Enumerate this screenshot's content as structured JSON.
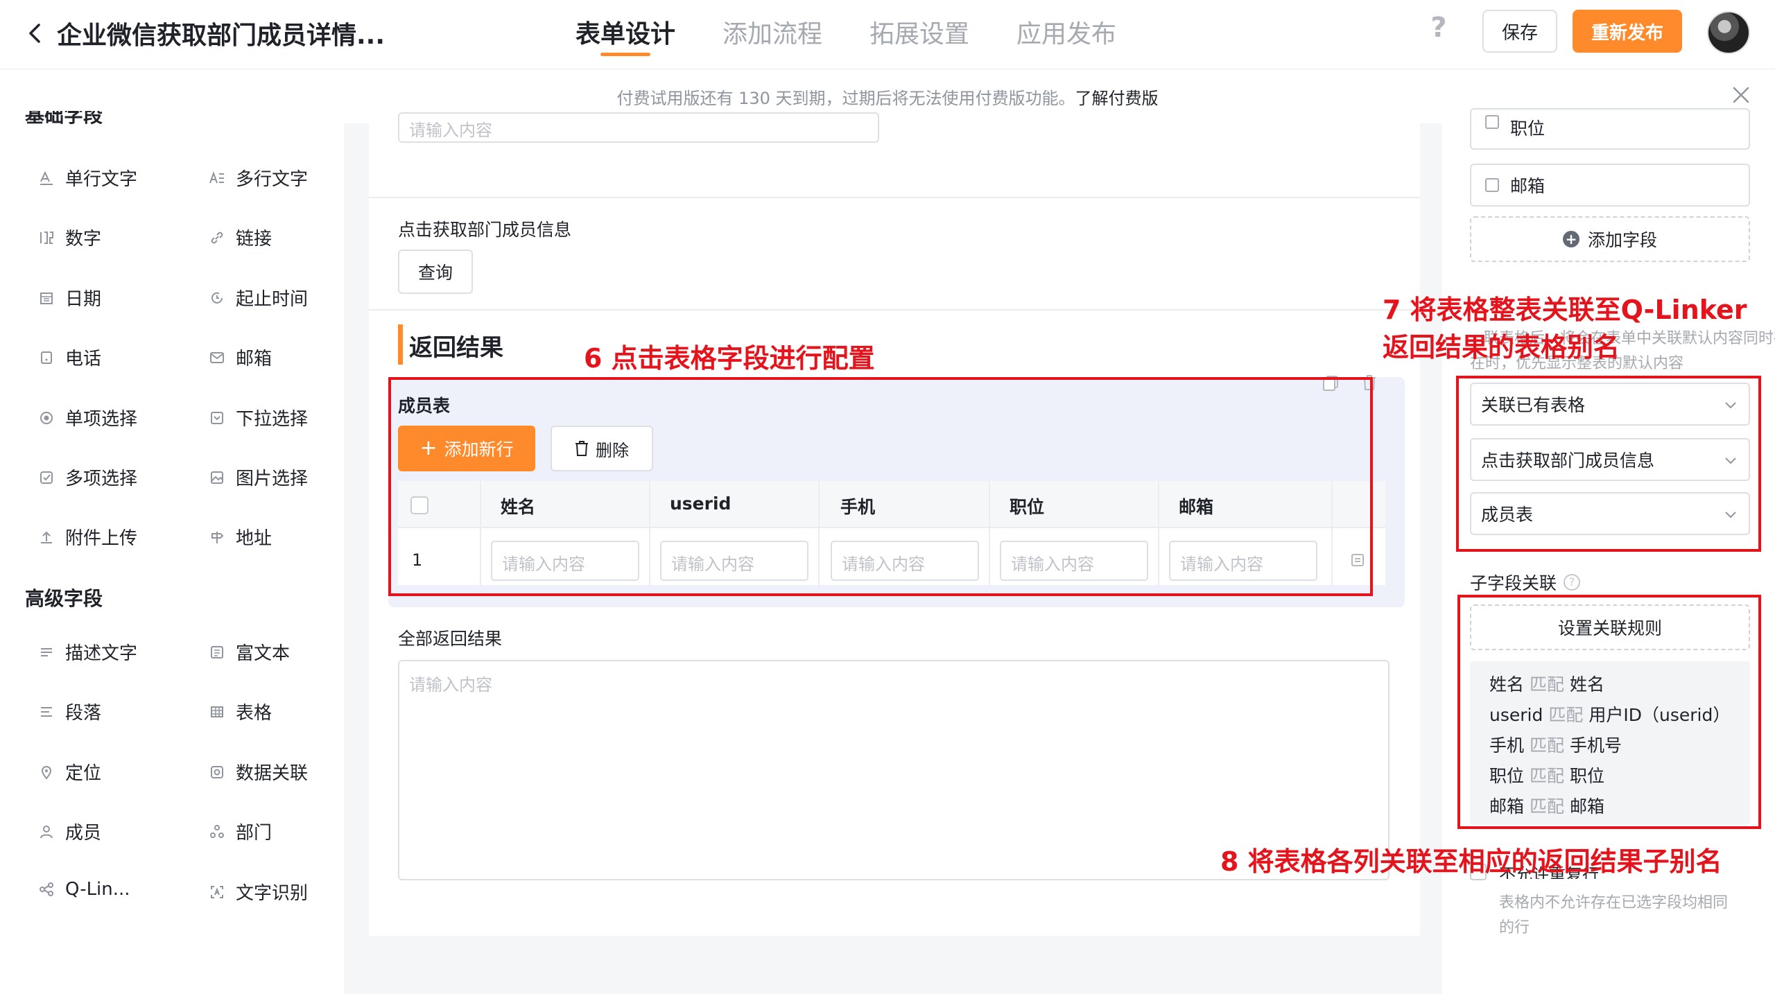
{
  "header": {
    "title": "企业微信获取部门成员详情...",
    "tabs": [
      {
        "label": "表单设计"
      },
      {
        "label": "添加流程"
      },
      {
        "label": "拓展设置"
      },
      {
        "label": "应用发布"
      }
    ],
    "help_glyph": "?",
    "save_label": "保存",
    "publish_label": "重新发布"
  },
  "notice": {
    "text": "付费试用版还有 130 天到期，过期后将无法使用付费版功能。",
    "link": "了解付费版"
  },
  "left_panel": {
    "basic_group_title": "基础字段",
    "advanced_group_title": "高级字段",
    "basic_items": [
      "单行文字",
      "多行文字",
      "数字",
      "链接",
      "日期",
      "起止时间",
      "电话",
      "邮箱",
      "单项选择",
      "下拉选择",
      "多项选择",
      "图片选择",
      "附件上传",
      "地址"
    ],
    "advanced_items": [
      "描述文字",
      "富文本",
      "段落",
      "表格",
      "定位",
      "数据关联",
      "成员",
      "部门",
      "Q-Lin...",
      "文字识别"
    ]
  },
  "canvas": {
    "top_input_placeholder": "请输入内容",
    "query_section_label": "点击获取部门成员信息",
    "query_button": "查询",
    "result_section_title": "返回结果",
    "table": {
      "name": "成员表",
      "add_row_label": "添加新行",
      "delete_label": "删除",
      "columns": [
        "姓名",
        "userid",
        "手机",
        "职位",
        "邮箱"
      ],
      "rows": [
        {
          "index": "1",
          "placeholder": "请输入内容"
        }
      ]
    },
    "all_results_label": "全部返回结果",
    "all_results_placeholder": "请输入内容"
  },
  "right_panel": {
    "fields": [
      "职位",
      "邮箱"
    ],
    "add_field_label": "添加字段",
    "faded_line1": "联表格后，将会在表单中关联默认内容同时存",
    "faded_line2": "在时，优先显示整表的默认内容",
    "selects": [
      "关联已有表格",
      "点击获取部门成员信息",
      "成员表"
    ],
    "sub_field_title": "子字段关联",
    "sub_field_help": "?",
    "set_rule_label": "设置关联规则",
    "match_word": "匹配",
    "rules": [
      {
        "left": "姓名",
        "right": "姓名"
      },
      {
        "left": "userid",
        "right": "用户ID（userid）"
      },
      {
        "left": "手机",
        "right": "手机号"
      },
      {
        "left": "职位",
        "right": "职位"
      },
      {
        "left": "邮箱",
        "right": "邮箱"
      }
    ],
    "no_duplicate_label": "不允许重复行",
    "no_duplicate_desc1": "表格内不允许存在已选字段均相同",
    "no_duplicate_desc2": "的行"
  },
  "annotations": {
    "a6": "6 点击表格字段进行配置",
    "a7_line1": "7 将表格整表关联至Q-Linker",
    "a7_line2": "返回结果的表格别名",
    "a8": "8 将表格各列关联至相应的返回结果子别名",
    "color": "#e5141c"
  },
  "colors": {
    "accent": "#ff8a2b",
    "annotation": "#e5141c"
  }
}
